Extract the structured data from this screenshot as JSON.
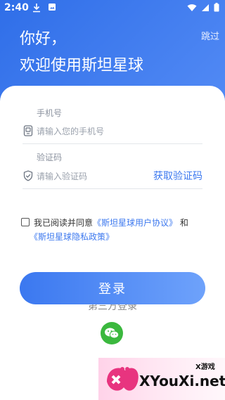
{
  "status": {
    "time": "2:40"
  },
  "header": {
    "skip_label": "跳过",
    "greeting_line1": "你好，",
    "greeting_line2": "欢迎使用斯坦星球"
  },
  "form": {
    "phone_label": "手机号",
    "phone_placeholder": "请输入您的手机号",
    "code_label": "验证码",
    "code_placeholder": "请输入验证码",
    "get_code_label": "获取验证码"
  },
  "agreement": {
    "prefix": "我已阅读并同意",
    "user_agreement": "《斯坦星球用户协议》",
    "connector": "和",
    "privacy_policy": "《斯坦星球隐私政策》",
    "checked": false
  },
  "login_label": "登录",
  "third_party_label": "第三方登录",
  "watermark": {
    "small": "X游戏",
    "large": "XYouXi.net"
  },
  "colors": {
    "accent": "#3d79ef",
    "wechat": "#3bb83e"
  }
}
